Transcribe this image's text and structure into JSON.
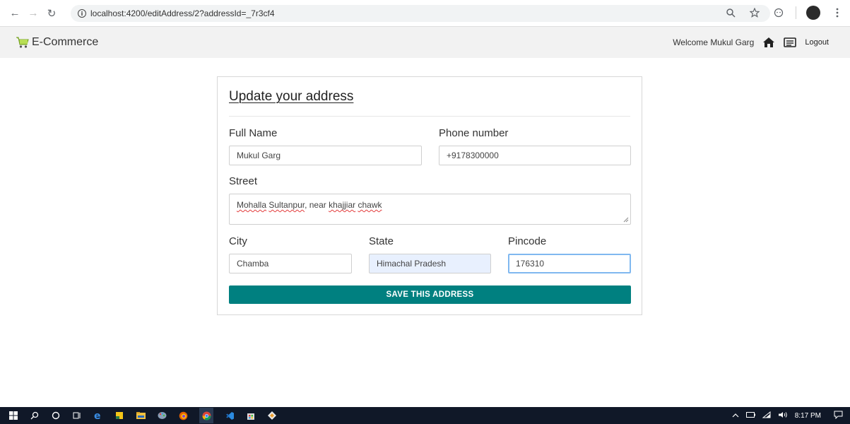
{
  "browser": {
    "url": "localhost:4200/editAddress/2?addressId=_7r3cf4",
    "icons": [
      "back-icon",
      "forward-icon",
      "reload-icon",
      "info-icon",
      "zoom-icon",
      "star-icon",
      "extension-icon",
      "profile-avatar",
      "menu-icon"
    ]
  },
  "header": {
    "brand": "E-Commerce",
    "welcome": "Welcome Mukul Garg",
    "logout": "Logout"
  },
  "form": {
    "title": "Update your address",
    "full_name_label": "Full Name",
    "full_name_value": "Mukul Garg",
    "phone_label": "Phone number",
    "phone_value": "+9178300000",
    "street_label": "Street",
    "street_value": {
      "part1": "Mohalla",
      "part2": "Sultanpur",
      "part3": ", near ",
      "part4": "khajjiar",
      "part5": "chawk"
    },
    "city_label": "City",
    "city_value": "Chamba",
    "state_label": "State",
    "state_value": "Himachal Pradesh",
    "pincode_label": "Pincode",
    "pincode_value": "176310",
    "save_label": "SAVE THIS ADDRESS"
  },
  "taskbar": {
    "time": "8:17 PM"
  },
  "colors": {
    "accent": "#008080",
    "header_bg": "#f2f2f2",
    "autofill_bg": "#e8f0fe",
    "focus_border": "#80b8f0"
  }
}
